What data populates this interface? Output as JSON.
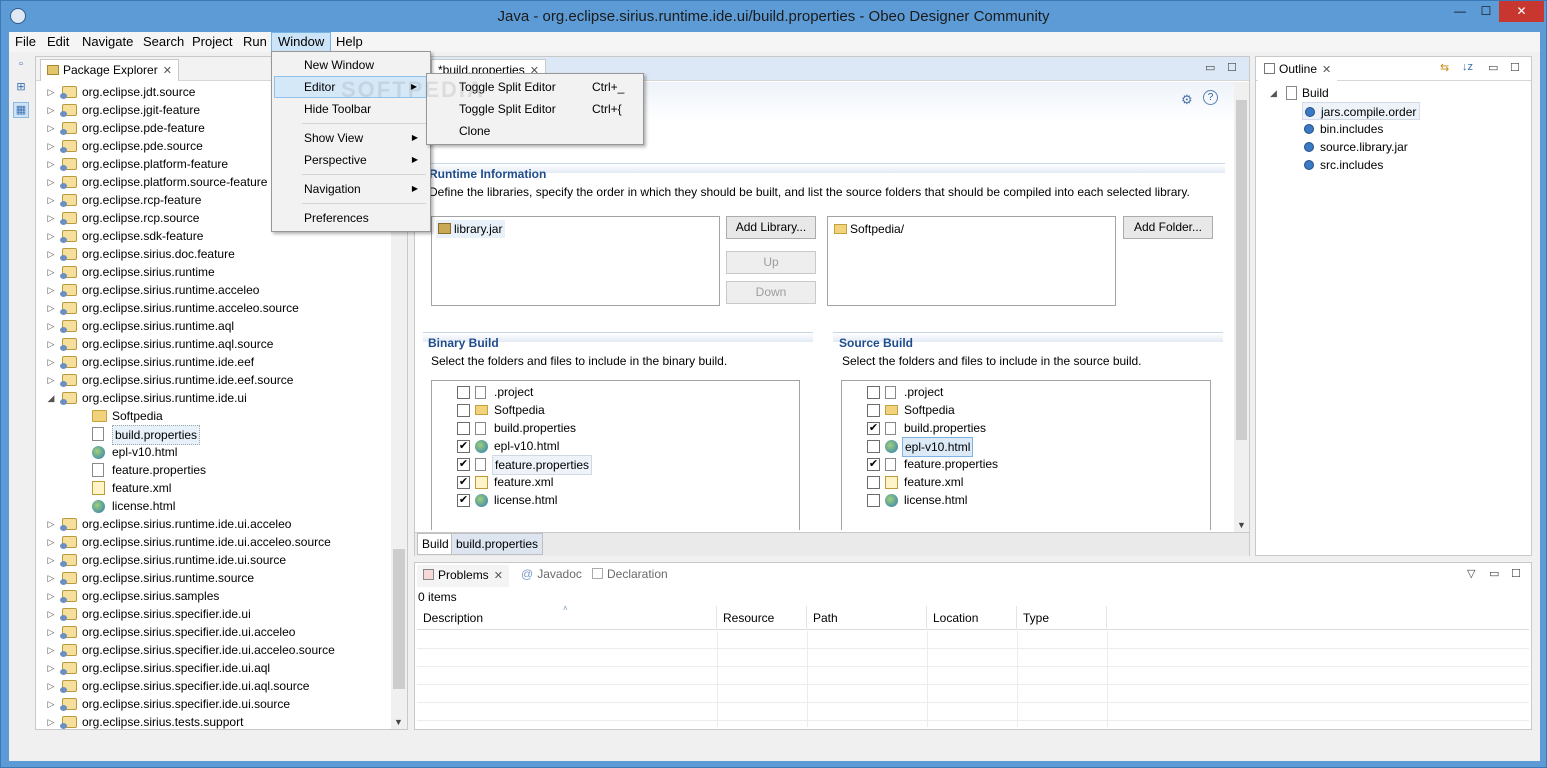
{
  "window": {
    "title": "Java - org.eclipse.sirius.runtime.ide.ui/build.properties - Obeo Designer Community",
    "minimize": "—",
    "maximize": "☐",
    "close": "✕"
  },
  "menubar": [
    "File",
    "Edit",
    "Navigate",
    "Search",
    "Project",
    "Run",
    "Window",
    "Help"
  ],
  "window_menu": {
    "items": [
      "New Window",
      "Editor",
      "Hide Toolbar",
      "Show View",
      "Perspective",
      "Navigation",
      "Preferences"
    ]
  },
  "editor_submenu": {
    "items": [
      {
        "label": "Toggle Split Editor",
        "accel": "Ctrl+_"
      },
      {
        "label": "Toggle Split Editor",
        "accel": "Ctrl+{"
      },
      {
        "label": "Clone",
        "accel": ""
      }
    ]
  },
  "package_explorer": {
    "tab": "Package Explorer",
    "items": [
      "org.eclipse.jdt.source",
      "org.eclipse.jgit-feature",
      "org.eclipse.pde-feature",
      "org.eclipse.pde.source",
      "org.eclipse.platform-feature",
      "org.eclipse.platform.source-feature",
      "org.eclipse.rcp-feature",
      "org.eclipse.rcp.source",
      "org.eclipse.sdk-feature",
      "org.eclipse.sirius.doc.feature",
      "org.eclipse.sirius.runtime",
      "org.eclipse.sirius.runtime.acceleo",
      "org.eclipse.sirius.runtime.acceleo.source",
      "org.eclipse.sirius.runtime.aql",
      "org.eclipse.sirius.runtime.aql.source",
      "org.eclipse.sirius.runtime.ide.eef",
      "org.eclipse.sirius.runtime.ide.eef.source",
      "org.eclipse.sirius.runtime.ide.ui",
      "Softpedia",
      "build.properties",
      "epl-v10.html",
      "feature.properties",
      "feature.xml",
      "license.html",
      "org.eclipse.sirius.runtime.ide.ui.acceleo",
      "org.eclipse.sirius.runtime.ide.ui.acceleo.source",
      "org.eclipse.sirius.runtime.ide.ui.source",
      "org.eclipse.sirius.runtime.source",
      "org.eclipse.sirius.samples",
      "org.eclipse.sirius.specifier.ide.ui",
      "org.eclipse.sirius.specifier.ide.ui.acceleo",
      "org.eclipse.sirius.specifier.ide.ui.acceleo.source",
      "org.eclipse.sirius.specifier.ide.ui.aql",
      "org.eclipse.sirius.specifier.ide.ui.aql.source",
      "org.eclipse.sirius.specifier.ide.ui.source",
      "org.eclipse.sirius.tests.support"
    ]
  },
  "editor": {
    "tab": "*build.properties",
    "runtime": {
      "title": "Runtime Information",
      "desc": "Define the libraries, specify the order in which they should be built, and list the source folders that should be compiled into each selected library.",
      "library": "library.jar",
      "folder": "Softpedia/",
      "add_library": "Add Library...",
      "up": "Up",
      "down": "Down",
      "add_folder": "Add Folder..."
    },
    "binary": {
      "title": "Binary Build",
      "desc": "Select the folders and files to include in the binary build.",
      "items": [
        {
          "label": ".project",
          "checked": false
        },
        {
          "label": "Softpedia",
          "checked": false
        },
        {
          "label": "build.properties",
          "checked": false
        },
        {
          "label": "epl-v10.html",
          "checked": true
        },
        {
          "label": "feature.properties",
          "checked": true
        },
        {
          "label": "feature.xml",
          "checked": true
        },
        {
          "label": "license.html",
          "checked": true
        }
      ]
    },
    "source": {
      "title": "Source Build",
      "desc": "Select the folders and files to include in the source build.",
      "items": [
        {
          "label": ".project",
          "checked": false
        },
        {
          "label": "Softpedia",
          "checked": false
        },
        {
          "label": "build.properties",
          "checked": true
        },
        {
          "label": "epl-v10.html",
          "checked": false
        },
        {
          "label": "feature.properties",
          "checked": true
        },
        {
          "label": "feature.xml",
          "checked": false
        },
        {
          "label": "license.html",
          "checked": false
        }
      ]
    },
    "bottom_tabs": [
      "Build",
      "build.properties"
    ],
    "checkmark": "✔"
  },
  "outline": {
    "tab": "Outline",
    "root": "Build",
    "items": [
      "jars.compile.order",
      "bin.includes",
      "source.library.jar",
      "src.includes"
    ]
  },
  "problems": {
    "tabs": [
      "Problems",
      "Javadoc",
      "Declaration"
    ],
    "count": "0 items",
    "columns": [
      "Description",
      "Resource",
      "Path",
      "Location",
      "Type"
    ]
  },
  "watermark": "SOFTPEDIA"
}
